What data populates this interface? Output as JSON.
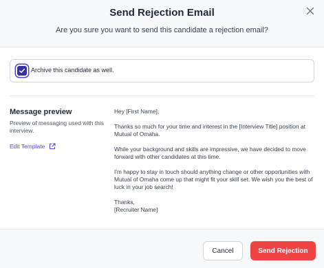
{
  "dialog": {
    "title": "Send Rejection Email",
    "subtitle": "Are you sure you want to send this candidate a rejection email?",
    "close_icon": "close-icon"
  },
  "archive": {
    "checked": true,
    "label": "Archive this candidate as well."
  },
  "preview": {
    "title": "Message preview",
    "description": "Preview of messaging used with this interview.",
    "edit_label": "Edit Template",
    "edit_icon": "external-link-icon"
  },
  "message": {
    "greeting": "Hey [First Name],",
    "paragraph1": "Thanks so much for your time and interest in the [Interview Title] position at Mutual of Omaha.",
    "paragraph2": "While your background and skills are impressive, we have decided to move forward with other candidates at this time.",
    "paragraph3": "I'm happy to stay in touch should anything change or other opportunities with Mutual of Omaha come up that might fit your skill set. We wish you the best of luck in your job search!",
    "signoff": "Thanks,",
    "signature": "[Recruiter Name]"
  },
  "footer": {
    "cancel_label": "Cancel",
    "send_label": "Send Rejection"
  },
  "colors": {
    "accent": "#4f46e5",
    "danger": "#ef4444",
    "checkbox": "#3730a3"
  }
}
